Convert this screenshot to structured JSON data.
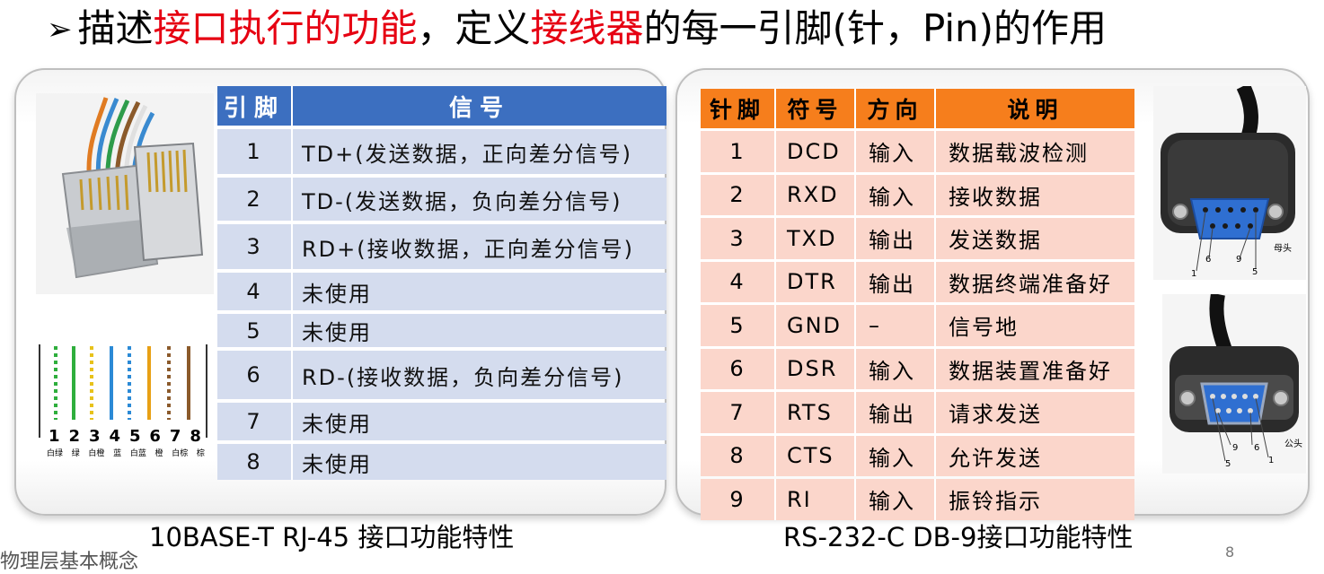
{
  "title": {
    "bullet": "➢",
    "part1": "描述",
    "part2": "接口执行的功能",
    "part3": "，定义",
    "part4": "接线器",
    "part5": "的每一引脚(针，Pin)的作用"
  },
  "rj45": {
    "headers": [
      "引脚",
      "信号"
    ],
    "rows": [
      {
        "pin": "1",
        "signal": "TD+(发送数据，正向差分信号)"
      },
      {
        "pin": "2",
        "signal": "TD-(发送数据，负向差分信号)"
      },
      {
        "pin": "3",
        "signal": "RD+(接收数据，正向差分信号)"
      },
      {
        "pin": "4",
        "signal": "未使用"
      },
      {
        "pin": "5",
        "signal": "未使用"
      },
      {
        "pin": "6",
        "signal": "RD-(接收数据，负向差分信号)"
      },
      {
        "pin": "7",
        "signal": "未使用"
      },
      {
        "pin": "8",
        "signal": "未使用"
      }
    ],
    "wire_numbers": [
      "1",
      "2",
      "3",
      "4",
      "5",
      "6",
      "7",
      "8"
    ],
    "wire_colors": [
      "白绿",
      "绿",
      "白橙",
      "蓝",
      "白蓝",
      "橙",
      "白棕",
      "棕"
    ],
    "caption": "10BASE-T RJ-45 接口功能特性"
  },
  "db9": {
    "headers": [
      "针脚",
      "符号",
      "方向",
      "说明"
    ],
    "rows": [
      {
        "pin": "1",
        "symbol": "DCD",
        "dir": "输入",
        "desc": "数据载波检测"
      },
      {
        "pin": "2",
        "symbol": "RXD",
        "dir": "输入",
        "desc": "接收数据"
      },
      {
        "pin": "3",
        "symbol": "TXD",
        "dir": "输出",
        "desc": "发送数据"
      },
      {
        "pin": "4",
        "symbol": "DTR",
        "dir": "输出",
        "desc": "数据终端准备好"
      },
      {
        "pin": "5",
        "symbol": "GND",
        "dir": "–",
        "desc": "信号地"
      },
      {
        "pin": "6",
        "symbol": "DSR",
        "dir": "输入",
        "desc": "数据装置准备好"
      },
      {
        "pin": "7",
        "symbol": "RTS",
        "dir": "输出",
        "desc": "请求发送"
      },
      {
        "pin": "8",
        "symbol": "CTS",
        "dir": "输入",
        "desc": "允许发送"
      },
      {
        "pin": "9",
        "symbol": "RI",
        "dir": "输入",
        "desc": "振铃指示"
      }
    ],
    "female_label": "母头",
    "male_label": "公头",
    "female_pins": [
      "1",
      "6",
      "9",
      "5"
    ],
    "male_pins": [
      "5",
      "9",
      "6",
      "1"
    ],
    "caption": "RS-232-C DB-9接口功能特性"
  },
  "footer": "物理层基本概念",
  "page_number": "8",
  "colors": {
    "title_red": "#e60012",
    "rj_header": "#3c6fc0",
    "rj_cell": "#d4dcee",
    "db_header": "#f67e1c",
    "db_cell": "#fbd6cb",
    "connector_blue": "#2f6fd1"
  }
}
